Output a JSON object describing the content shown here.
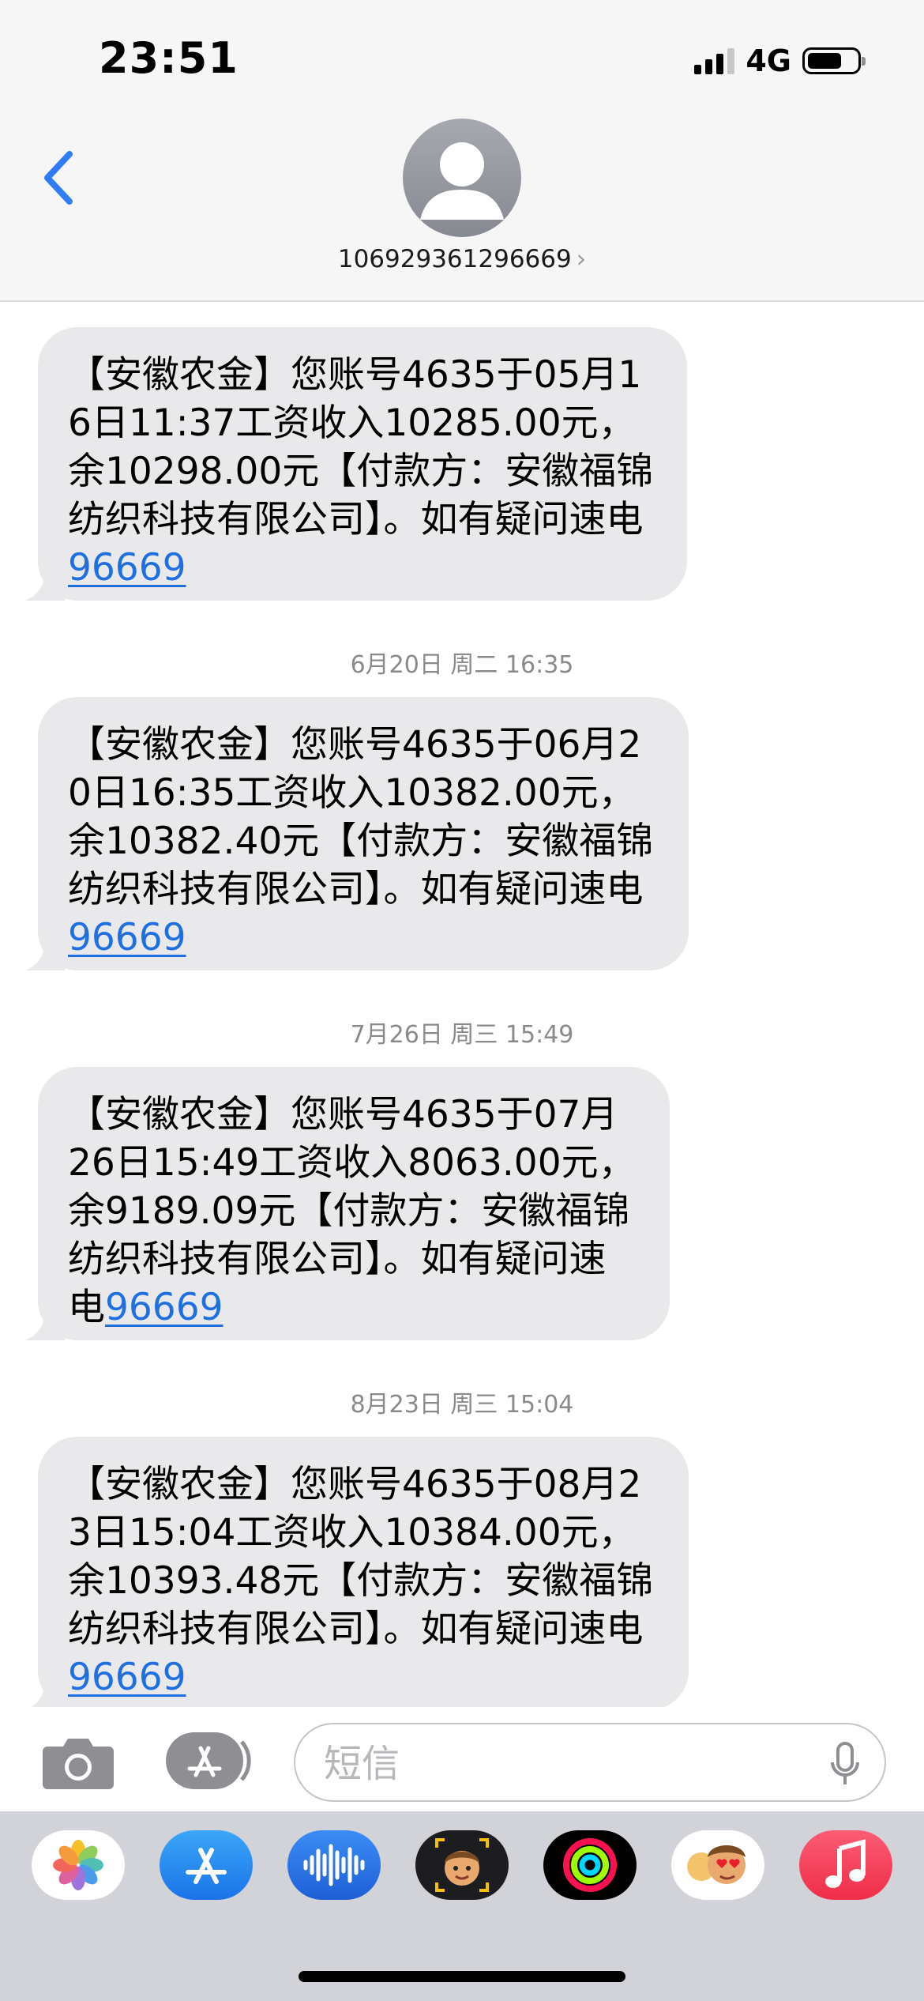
{
  "status_bar": {
    "time": "23:51",
    "network": "4G"
  },
  "header": {
    "contact": "106929361296669",
    "chevron": "›"
  },
  "messages": [
    {
      "text": "【安徽农金】您账号4635于05月16日11:37工资收入10285.00元，余10298.00元【付款方：安徽福锦纺织科技有限公司】。如有疑问速电",
      "link": "96669"
    },
    {
      "text": "【安徽农金】您账号4635于06月20日16:35工资收入10382.00元，余10382.40元【付款方：安徽福锦纺织科技有限公司】。如有疑问速电",
      "link": "96669"
    },
    {
      "text": "【安徽农金】您账号4635于07月26日15:49工资收入8063.00元，余9189.09元【付款方：安徽福锦纺织科技有限公司】。如有疑问速电",
      "link": "96669"
    },
    {
      "text": "【安徽农金】您账号4635于08月23日15:04工资收入10384.00元，余10393.48元【付款方：安徽福锦纺织科技有限公司】。如有疑问速电",
      "link": "96669"
    }
  ],
  "timestamps": [
    "6月20日 周二 16:35",
    "7月26日 周三 15:49",
    "8月23日 周三 15:04"
  ],
  "input": {
    "placeholder": "短信"
  },
  "icons": {
    "back": "chevron-left-icon",
    "camera": "camera-icon",
    "apps": "app-store-icon",
    "mic": "microphone-icon",
    "drawer": [
      "photos-icon",
      "app-store-icon",
      "audio-message-icon",
      "memoji-icon",
      "activity-icon",
      "memoji-stickers-icon",
      "music-icon"
    ]
  },
  "colors": {
    "bubble": "#e9e9eb",
    "link": "#1f6fe0",
    "accent": "#2f7cf6"
  }
}
